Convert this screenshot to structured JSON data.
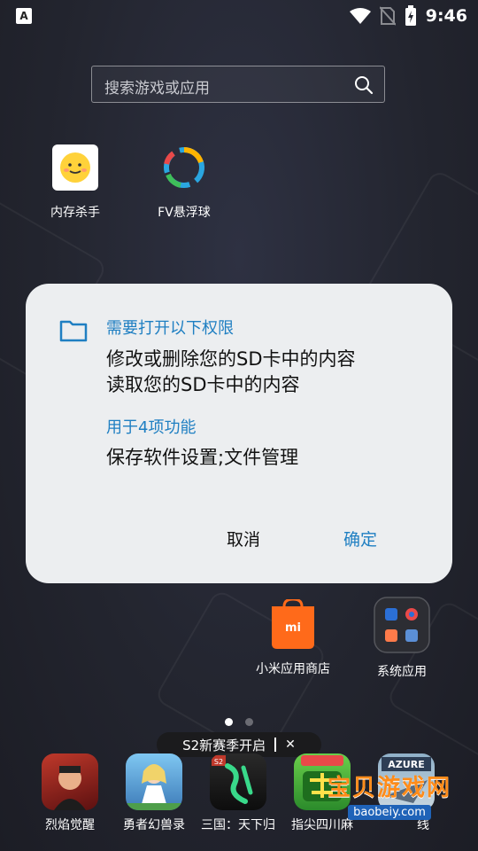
{
  "status_bar": {
    "time": "9:46",
    "app_icon_letter": "A"
  },
  "search": {
    "placeholder": "搜索游戏或应用"
  },
  "apps_top": [
    {
      "label": "内存杀手",
      "icon": "memory-killer-icon"
    },
    {
      "label": "FV悬浮球",
      "icon": "floating-ball-icon"
    }
  ],
  "apps_mid": [
    {
      "label": "小米应用商店",
      "icon": "mi-store-icon",
      "logo_text": "mi"
    },
    {
      "label": "系统应用",
      "icon": "system-apps-folder-icon"
    }
  ],
  "dialog": {
    "heading": "需要打开以下权限",
    "permissions": [
      "修改或删除您的SD卡中的内容",
      "读取您的SD卡中的内容"
    ],
    "function_heading": "用于4项功能",
    "function_text": "保存软件设置;文件管理",
    "cancel_label": "取消",
    "confirm_label": "确定"
  },
  "promo": {
    "text": "S2新赛季开启",
    "close": "✕"
  },
  "dock": [
    {
      "label": "烈焰觉醒"
    },
    {
      "label": "勇者幻兽录"
    },
    {
      "label": "三国：天下归"
    },
    {
      "label": "指尖四川麻"
    },
    {
      "label": "线"
    }
  ],
  "watermark": {
    "title": "宝贝游戏网",
    "url": "baobeiy.com"
  },
  "colors": {
    "accent": "#1f7fc2",
    "dialog_bg": "#eceef0",
    "mi_orange": "#ff6a1a"
  }
}
